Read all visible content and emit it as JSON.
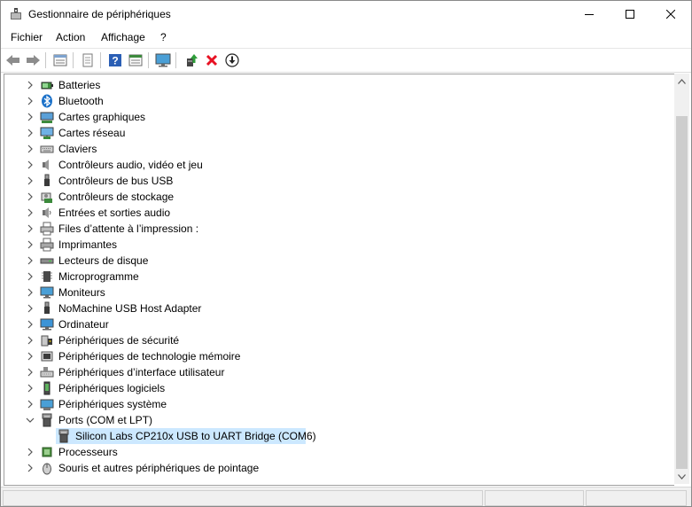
{
  "window": {
    "title": "Gestionnaire de périphériques"
  },
  "menu": {
    "items": [
      "Fichier",
      "Action",
      "Affichage",
      "?"
    ]
  },
  "toolbar": {
    "buttons": [
      "back-icon",
      "forward-icon",
      "properties-icon",
      "print-icon",
      "help-icon",
      "view-icon",
      "monitor-icon",
      "update-driver-icon",
      "uninstall-icon",
      "download-icon"
    ]
  },
  "tree": {
    "items": [
      {
        "label": "Batteries",
        "icon": "battery-icon",
        "expanded": false
      },
      {
        "label": "Bluetooth",
        "icon": "bluetooth-icon",
        "expanded": false
      },
      {
        "label": "Cartes graphiques",
        "icon": "display-adapter-icon",
        "expanded": false
      },
      {
        "label": "Cartes réseau",
        "icon": "network-adapter-icon",
        "expanded": false
      },
      {
        "label": "Claviers",
        "icon": "keyboard-icon",
        "expanded": false
      },
      {
        "label": "Contrôleurs audio, vidéo et jeu",
        "icon": "speaker-icon",
        "expanded": false
      },
      {
        "label": "Contrôleurs de bus USB",
        "icon": "usb-icon",
        "expanded": false
      },
      {
        "label": "Contrôleurs de stockage",
        "icon": "storage-controller-icon",
        "expanded": false
      },
      {
        "label": "Entrées et sorties audio",
        "icon": "audio-io-icon",
        "expanded": false
      },
      {
        "label": "Files d’attente à l’impression :",
        "icon": "print-queue-icon",
        "expanded": false
      },
      {
        "label": "Imprimantes",
        "icon": "printer-icon",
        "expanded": false
      },
      {
        "label": "Lecteurs de disque",
        "icon": "disk-drive-icon",
        "expanded": false
      },
      {
        "label": "Microprogramme",
        "icon": "firmware-chip-icon",
        "expanded": false
      },
      {
        "label": "Moniteurs",
        "icon": "monitor-icon",
        "expanded": false
      },
      {
        "label": "NoMachine USB Host Adapter",
        "icon": "usb-icon",
        "expanded": false
      },
      {
        "label": "Ordinateur",
        "icon": "computer-icon",
        "expanded": false
      },
      {
        "label": "Périphériques de sécurité",
        "icon": "security-device-icon",
        "expanded": false
      },
      {
        "label": "Périphériques de technologie mémoire",
        "icon": "memory-device-icon",
        "expanded": false
      },
      {
        "label": "Périphériques d’interface utilisateur",
        "icon": "hid-icon",
        "expanded": false
      },
      {
        "label": "Périphériques logiciels",
        "icon": "software-device-icon",
        "expanded": false
      },
      {
        "label": "Périphériques système",
        "icon": "system-device-icon",
        "expanded": false
      },
      {
        "label": "Ports (COM et LPT)",
        "icon": "port-icon",
        "expanded": true
      },
      {
        "label": "Silicon Labs CP210x USB to UART Bridge (COM6)",
        "icon": "port-icon",
        "child": true,
        "selected": true
      },
      {
        "label": "Processeurs",
        "icon": "processor-icon",
        "expanded": false
      },
      {
        "label": "Souris et autres périphériques de pointage",
        "icon": "mouse-icon",
        "expanded": false
      }
    ]
  },
  "colors": {
    "selection": "#cce8ff",
    "accent": "#0078d7",
    "uninstall": "#e81123"
  }
}
